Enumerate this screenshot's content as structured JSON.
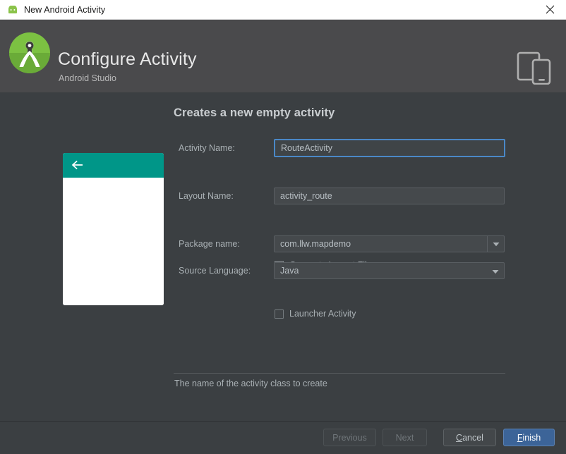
{
  "window": {
    "title": "New Android Activity",
    "icon": "android-robot-icon",
    "close_label": "close-icon"
  },
  "header": {
    "title": "Configure Activity",
    "subtitle": "Android Studio",
    "logo": "android-studio-logo",
    "device_icon": "tablet-phone-icon"
  },
  "main": {
    "section_title": "Creates a new empty activity",
    "preview": {
      "appbar_color": "#009688",
      "back_icon": "back-arrow-icon"
    },
    "fields": {
      "activity_name": {
        "label": "Activity Name:",
        "value": "RouteActivity",
        "focused": true
      },
      "generate_layout": {
        "label": "Generate Layout File",
        "checked": true
      },
      "layout_name": {
        "label": "Layout Name:",
        "value": "activity_route"
      },
      "launcher_activity": {
        "label": "Launcher Activity",
        "checked": false
      },
      "package_name": {
        "label": "Package name:",
        "value": "com.llw.mapdemo"
      },
      "source_language": {
        "label": "Source Language:",
        "value": "Java"
      }
    },
    "hint": "The name of the activity class to create"
  },
  "buttons": {
    "previous": "Previous",
    "next": "Next",
    "cancel_pre": "",
    "cancel_mnemonic": "C",
    "cancel_post": "ancel",
    "finish_mnemonic": "F",
    "finish_post": "inish"
  },
  "colors": {
    "accent_blue": "#3c6498",
    "focus_blue": "#4a88c7",
    "teal": "#009688",
    "header_bg": "#4a4a4c",
    "body_bg": "#3b3f42"
  }
}
